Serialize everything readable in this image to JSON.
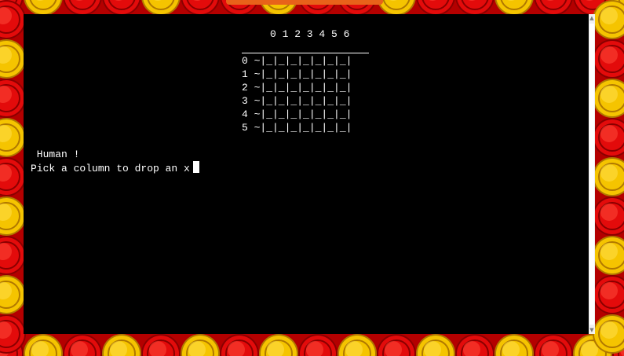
{
  "colors": {
    "page_background": "#b40000",
    "red_piece": "#e30b0b",
    "yellow_piece": "#f5c400",
    "terminal_background": "#000000",
    "terminal_text": "#ffffff",
    "top_tab": "#e8621a"
  },
  "terminal": {
    "column_header": "0 1 2 3 4 5 6",
    "board_rows": [
      "0 ~|_|_|_|_|_|_|_|",
      "1 ~|_|_|_|_|_|_|_|",
      "2 ~|_|_|_|_|_|_|_|",
      "3 ~|_|_|_|_|_|_|_|",
      "4 ~|_|_|_|_|_|_|_|",
      "5 ~|_|_|_|_|_|_|_|"
    ],
    "player_line": " Human !",
    "prompt": "Pick a column to drop an x"
  },
  "scrollbar": {
    "up_icon": "triangle-up-icon",
    "down_icon": "triangle-down-icon"
  }
}
